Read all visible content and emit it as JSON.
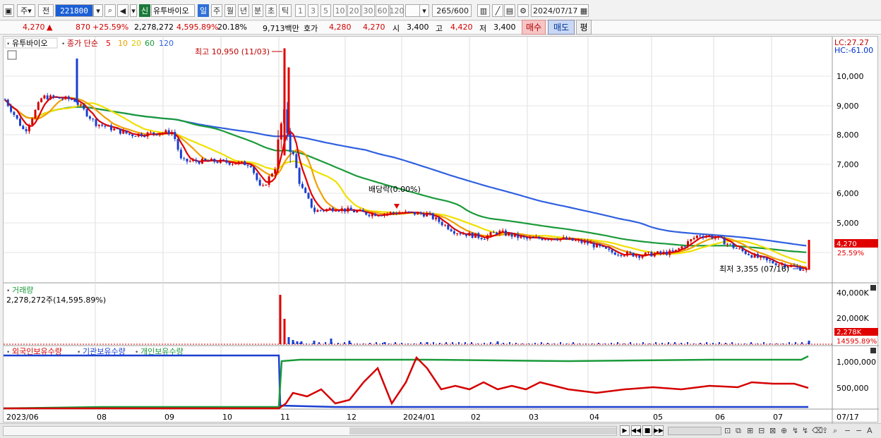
{
  "toolbar": {
    "market": "주",
    "prev_label": "전",
    "code": "221800",
    "stock_name": "유투바이오",
    "badge_new": "신",
    "periods": [
      "일",
      "주",
      "월",
      "년",
      "분",
      "초",
      "틱"
    ],
    "active_period": "일",
    "intervals": [
      "1",
      "3",
      "5",
      "10",
      "20",
      "30",
      "60",
      "120"
    ],
    "count": "265",
    "count_total": "/600",
    "date": "2024/07/17"
  },
  "infobar": {
    "price": "4,270",
    "change": "870",
    "change_rate": "+25.59%",
    "volume": "2,278,272",
    "volume_rate": "4,595.89%",
    "turnover": "20.18%",
    "amount": "9,713백만",
    "quote_label": "호가",
    "bid": "4,280",
    "ask": "4,270",
    "open_label": "시",
    "open": "3,400",
    "high_label": "고",
    "high": "4,420",
    "low_label": "저",
    "low": "3,400",
    "buy_button": "매수",
    "sell_button": "매도",
    "avg_button": "평"
  },
  "colors": {
    "up": "#d40000",
    "down": "#1a3fd0",
    "ma5": "#e00000",
    "ma10": "#f0a000",
    "ma20": "#f0e000",
    "ma60": "#1a9a3a",
    "ma120": "#3060e0"
  },
  "price_panel": {
    "name": "유투바이오",
    "indicator_label": "종가 단순",
    "ma_periods": [
      "5",
      "10",
      "20",
      "60",
      "120"
    ],
    "lc": "LC:27.27",
    "hc": "HC:-61.00",
    "max_annotation": "최고 10,950 (11/03)",
    "min_annotation": "최저 3,355 (07/16)",
    "dividend_annotation": "배당락(0.00%)",
    "current_price_tag": "4,270",
    "current_rate_tag": "25.59%",
    "y_ticks": [
      "10,000",
      "9,000",
      "8,000",
      "7,000",
      "6,000",
      "5,000"
    ]
  },
  "volume_panel": {
    "title": "거래량",
    "value": "2,278,272주(14,595.89%)",
    "y_ticks": [
      "40,000K",
      "20,000K"
    ],
    "current_tag": "2,278K",
    "rate_tag": "14595.89%"
  },
  "holder_panel": {
    "legends": [
      "외국인보유수량",
      "기관보유수량",
      "개인보유수량"
    ],
    "y_ticks": [
      "1,000,000",
      "500,000"
    ]
  },
  "x_axis": {
    "labels": [
      "2023/06",
      "08",
      "09",
      "10",
      "11",
      "12",
      "2024/01",
      "02",
      "03",
      "04",
      "05",
      "06",
      "07"
    ],
    "right_label": "07/17"
  }
}
